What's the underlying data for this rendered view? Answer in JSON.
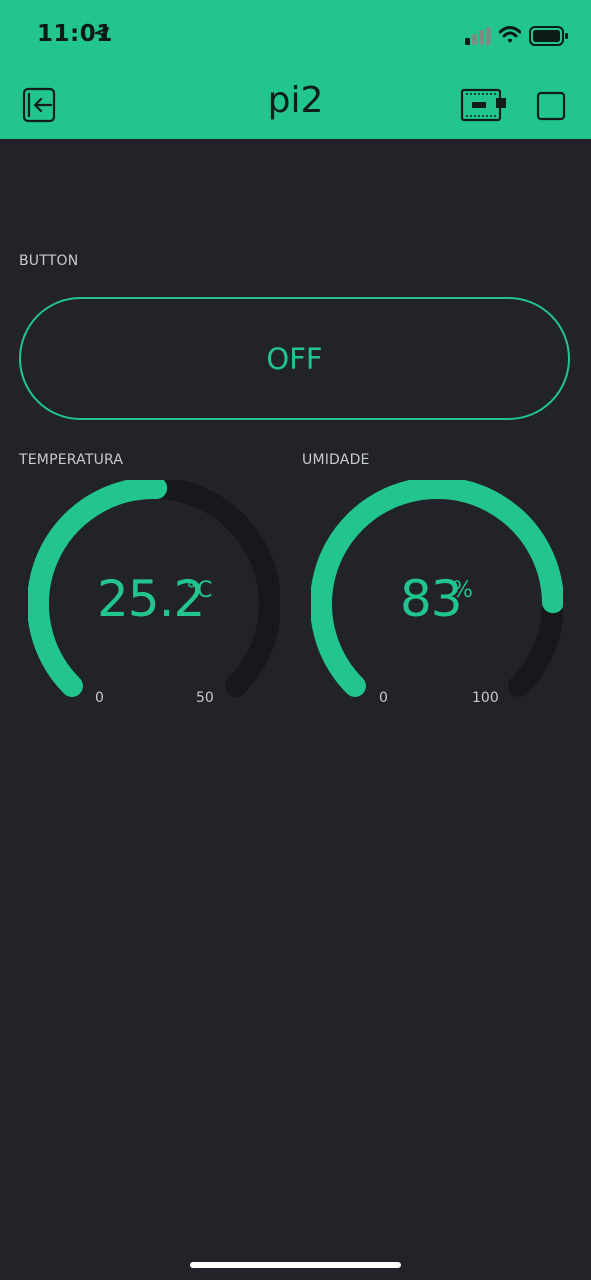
{
  "status_bar": {
    "time": "11:01",
    "icons": [
      "location-arrow-icon",
      "cellular-signal-icon",
      "wifi-icon",
      "battery-icon"
    ]
  },
  "header": {
    "title": "pi2",
    "left_icon": "exit-icon",
    "right_icons": [
      "device-icon",
      "stop-icon"
    ]
  },
  "button_widget": {
    "label": "BUTTON",
    "state_text": "OFF"
  },
  "gauges": [
    {
      "label": "TEMPERATURA",
      "value": "25.2",
      "unit": "°C",
      "min": "0",
      "max": "50",
      "fraction": 0.504
    },
    {
      "label": "UMIDADE",
      "value": "83",
      "unit": "%",
      "min": "0",
      "max": "100",
      "fraction": 0.83
    }
  ],
  "colors": {
    "accent": "#23c58f",
    "background": "#212328",
    "track": "#17181c",
    "label": "#c8cacc"
  }
}
